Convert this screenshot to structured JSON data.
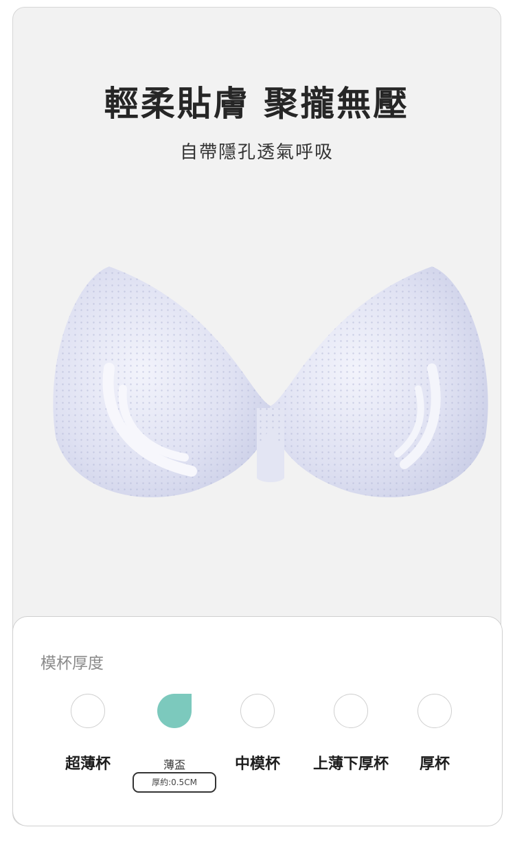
{
  "headline": "輕柔貼膚 聚攏無壓",
  "subheadline": "自帶隱孔透氣呼吸",
  "product_image": {
    "icon": "bra-cup-icon",
    "color": "#d9dcf0"
  },
  "thickness": {
    "title": "模杯厚度",
    "accent": "#7cc9bd",
    "options": [
      {
        "label": "超薄杯",
        "selected": false
      },
      {
        "label": "薄盃",
        "selected": true
      },
      {
        "label": "中模杯",
        "selected": false
      },
      {
        "label": "上薄下厚杯",
        "selected": false
      },
      {
        "label": "厚杯",
        "selected": false
      }
    ],
    "note": "厚約:0.5CM"
  }
}
